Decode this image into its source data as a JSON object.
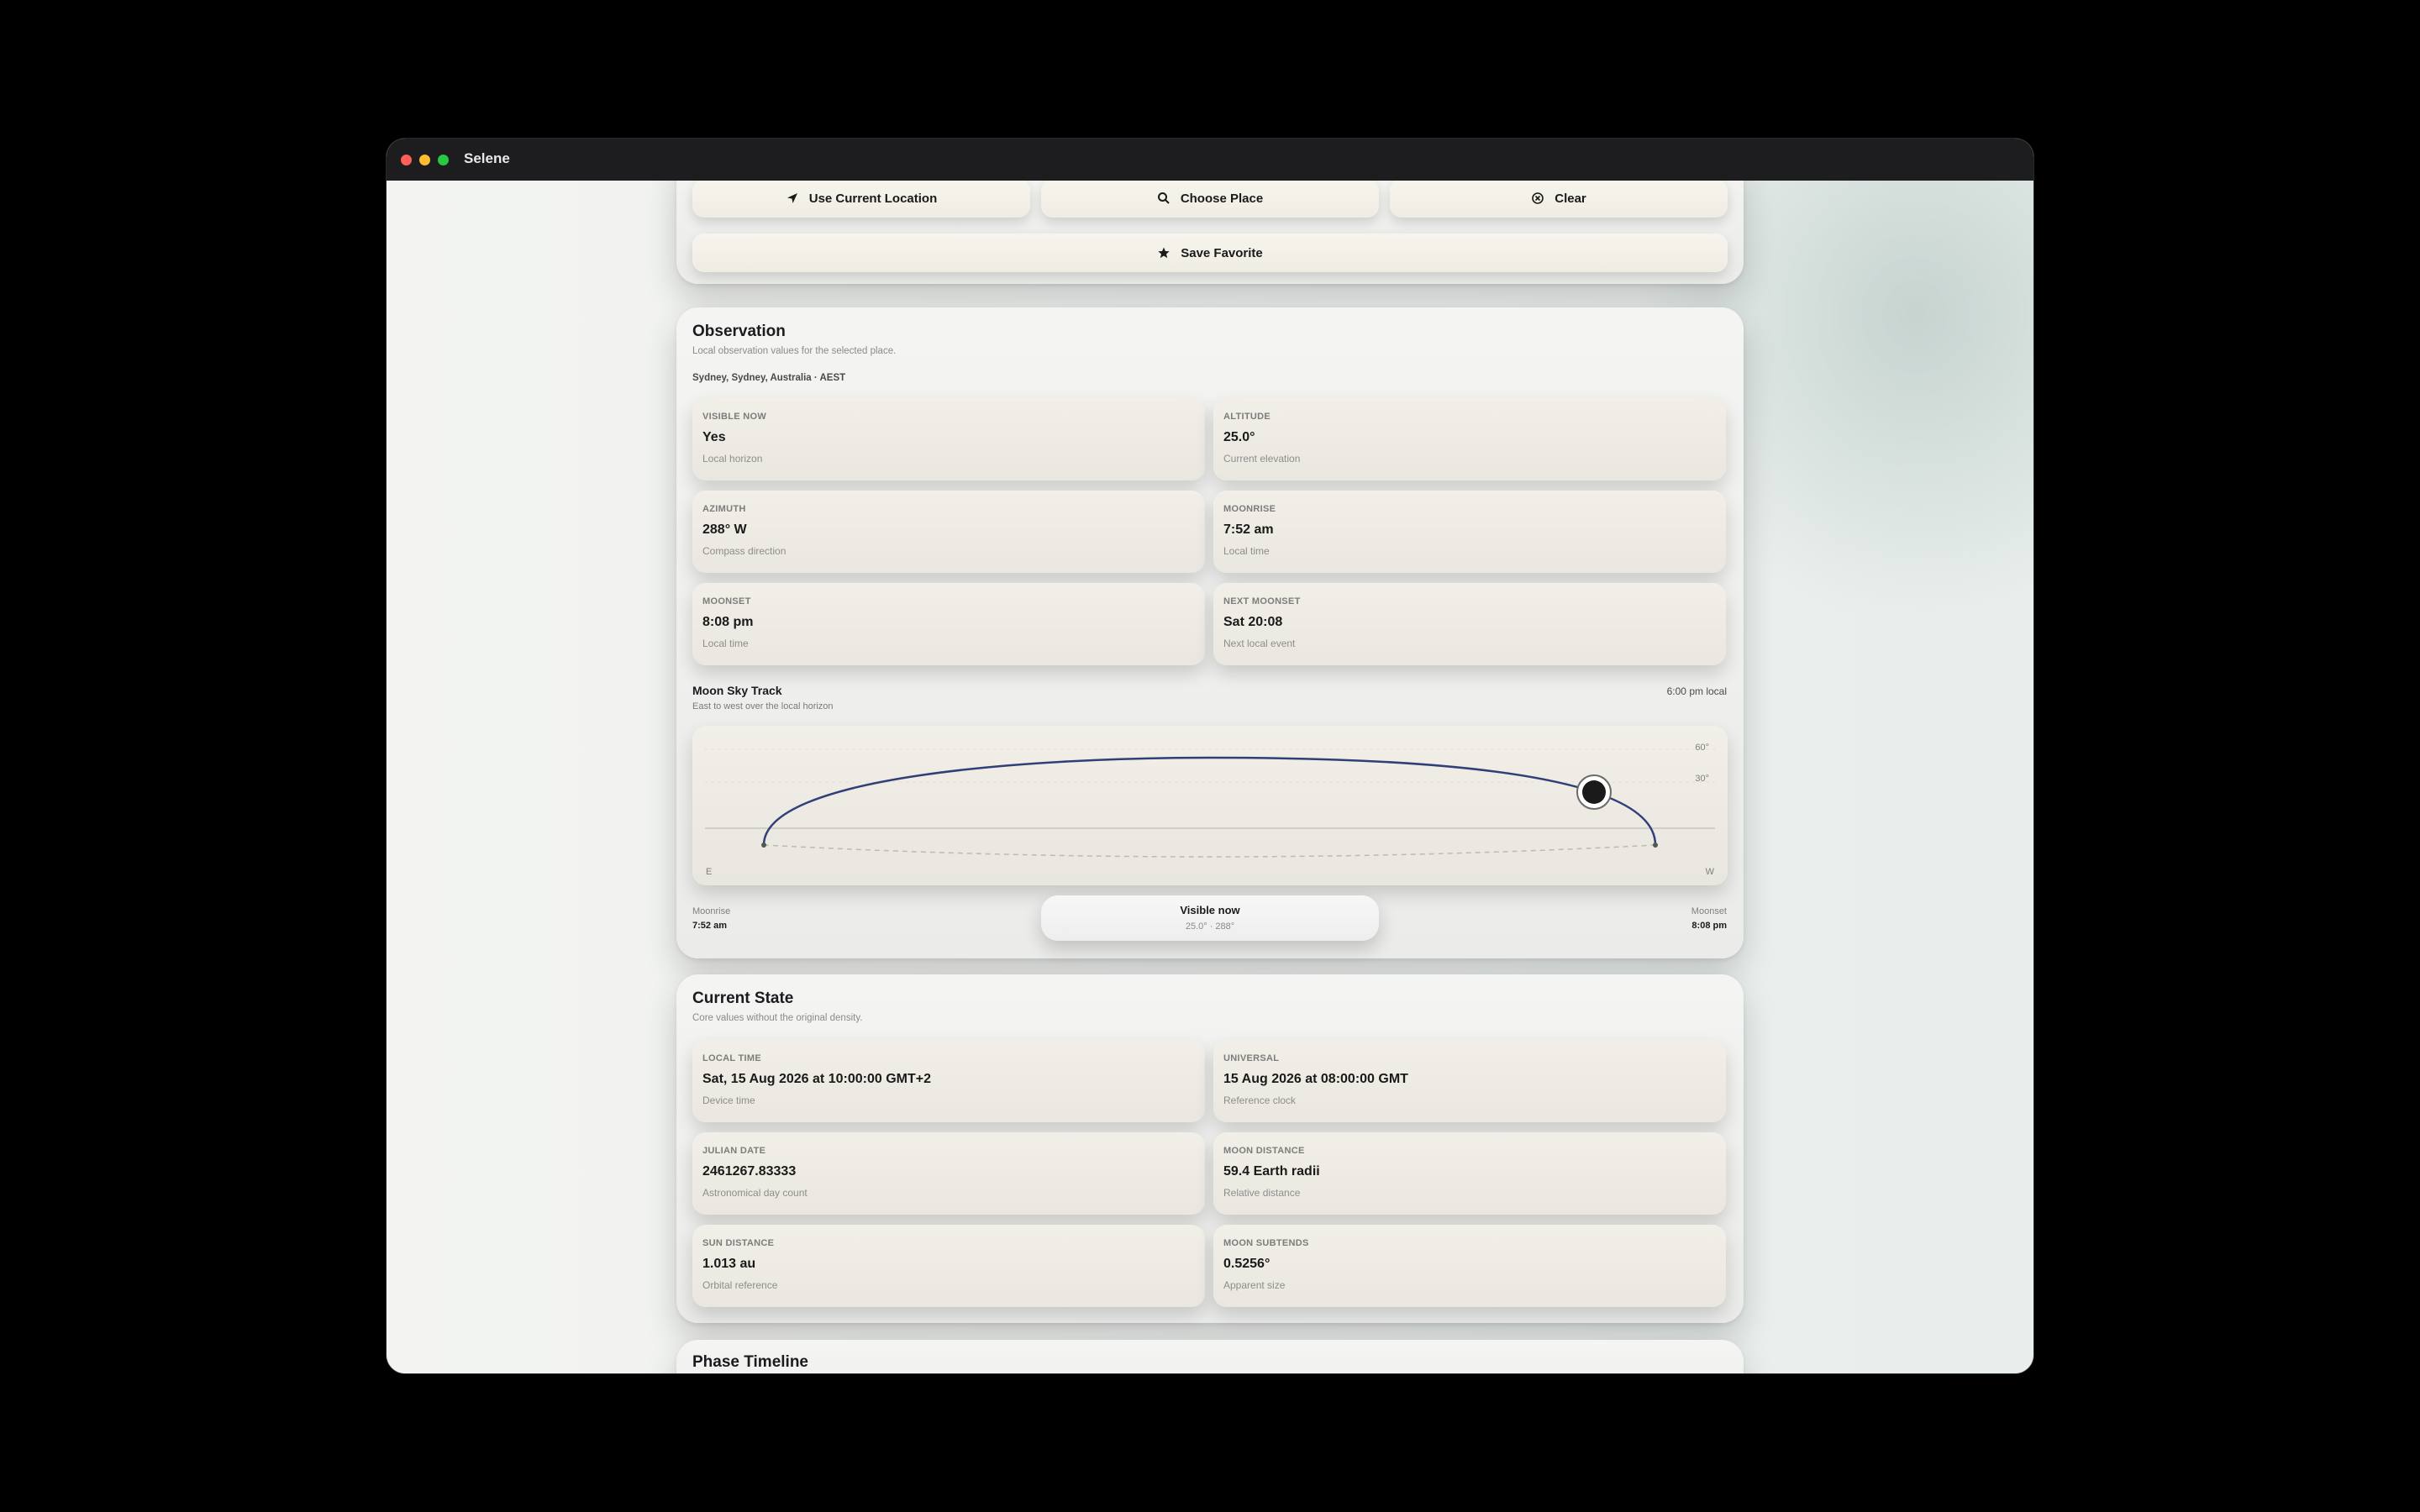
{
  "window": {
    "title": "Selene"
  },
  "location_actions": {
    "use_current": "Use Current Location",
    "choose_place": "Choose Place",
    "clear": "Clear",
    "save_favorite": "Save Favorite"
  },
  "observation": {
    "title": "Observation",
    "subtitle": "Local observation values for the selected place.",
    "place": "Sydney, Sydney, Australia · AEST",
    "cards": [
      {
        "label": "VISIBLE NOW",
        "value": "Yes",
        "note": "Local horizon"
      },
      {
        "label": "ALTITUDE",
        "value": "25.0°",
        "note": "Current elevation"
      },
      {
        "label": "AZIMUTH",
        "value": "288° W",
        "note": "Compass direction"
      },
      {
        "label": "MOONRISE",
        "value": "7:52 am",
        "note": "Local time"
      },
      {
        "label": "MOONSET",
        "value": "8:08 pm",
        "note": "Local time"
      },
      {
        "label": "NEXT MOONSET",
        "value": "Sat 20:08",
        "note": "Next local event"
      }
    ],
    "sky_track": {
      "title": "Moon Sky Track",
      "subtitle": "East to west over the local horizon",
      "time": "6:00 pm local",
      "axis_60": "60°",
      "axis_30": "30°",
      "east": "E",
      "west": "W",
      "moonrise_label": "Moonrise",
      "moonrise_time": "7:52 am",
      "moonset_label": "Moonset",
      "moonset_time": "8:08 pm",
      "status": "Visible now",
      "status_detail": "25.0° · 288°"
    }
  },
  "current_state": {
    "title": "Current State",
    "subtitle": "Core values without the original density.",
    "cards": [
      {
        "label": "LOCAL TIME",
        "value": "Sat, 15 Aug 2026 at 10:00:00 GMT+2",
        "note": "Device time"
      },
      {
        "label": "UNIVERSAL",
        "value": "15 Aug 2026 at 08:00:00 GMT",
        "note": "Reference clock"
      },
      {
        "label": "JULIAN DATE",
        "value": "2461267.83333",
        "note": "Astronomical day count"
      },
      {
        "label": "MOON DISTANCE",
        "value": "59.4 Earth radii",
        "note": "Relative distance"
      },
      {
        "label": "SUN DISTANCE",
        "value": "1.013 au",
        "note": "Orbital reference"
      },
      {
        "label": "MOON SUBTENDS",
        "value": "0.5256°",
        "note": "Apparent size"
      }
    ]
  },
  "phase_timeline": {
    "title": "Phase Timeline"
  },
  "colors": {
    "track": "#2f3f78",
    "moon": "#1a1a1a",
    "panel": "#f1f1f0"
  },
  "icons": [
    "location-arrow-icon",
    "search-icon",
    "clear-circle-icon",
    "star-icon"
  ]
}
